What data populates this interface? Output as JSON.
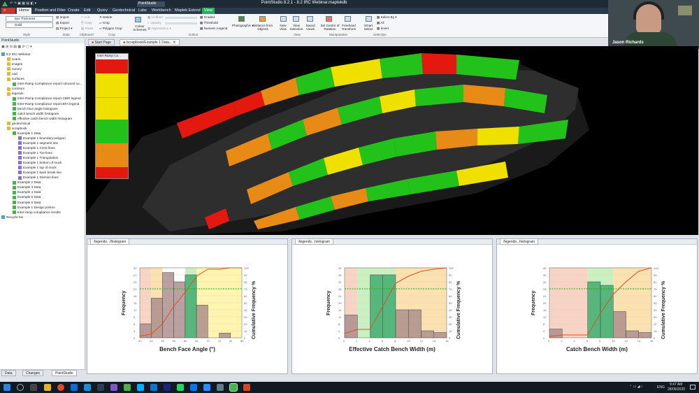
{
  "app": {
    "name": "PointStudio",
    "title": "PointStudio 8.2.1 - 8.2 IRC Webinar.maptekdb"
  },
  "menu": [
    "Home",
    "Position and Filter",
    "Create",
    "Edit",
    "Query",
    "Geotechnical",
    "Labs",
    "Workbench",
    "Maptek Extend",
    "View"
  ],
  "ribbon": {
    "style": {
      "thickness": "2px Thickness",
      "line": "Solid",
      "group": "Style"
    },
    "data": {
      "import": "Import",
      "export": "Export",
      "project": "Project",
      "group": "Data"
    },
    "clipboard": {
      "cut": "Cut",
      "copy": "Copy",
      "paste": "Paste",
      "group": "Clipboard"
    },
    "crop": {
      "delete": "Delete",
      "crop": "Crop",
      "polygon_crop": "Polygon Crop",
      "group": "Crop"
    },
    "colour": {
      "schemes": "Colour Schemes",
      "linflare": "Lin/flare",
      "opacity": "Opacity",
      "appearance": "Appearance",
      "graded": "Graded",
      "threshold": "Threshold",
      "numeric_legend": "Numeric Legend",
      "photographic": "Photographic",
      "distance": "Distance from Objects",
      "group": "Colour"
    },
    "view": {
      "new_view": "New View",
      "view_selection": "View Selection",
      "saved_views": "Saved Views",
      "group": "View"
    },
    "manipulation": {
      "centre": "Set Centre of Rotation",
      "freehand": "Freehand Transform",
      "group": "Manipulation"
    },
    "selection": {
      "smart": "Smart Select",
      "select_by": "Select By",
      "all": "All",
      "invert": "Invert",
      "group": "Selection"
    }
  },
  "webcam": {
    "name": "Jason Richards"
  },
  "project_panel": {
    "title": "PointStudio",
    "items": [
      {
        "label": "8.2 IRC Webinar",
        "level": 0
      },
      {
        "label": "scans",
        "level": 1
      },
      {
        "label": "images",
        "level": 1
      },
      {
        "label": "survey",
        "level": 1
      },
      {
        "label": "cad",
        "level": 1
      },
      {
        "label": "surfaces",
        "level": 1
      },
      {
        "label": "Inter-Ramp Compliance report coloured su...",
        "level": 2
      },
      {
        "label": "contours",
        "level": 1
      },
      {
        "label": "legends",
        "level": 1
      },
      {
        "label": "Inter-Ramp Compliance report CBW legend",
        "level": 2
      },
      {
        "label": "Inter-Ramp Compliance report BFA legend",
        "level": 2
      },
      {
        "label": "bench face angle histogram",
        "level": 2
      },
      {
        "label": "catch bench width histogram",
        "level": 2
      },
      {
        "label": "effective catch bench width histogram",
        "level": 2
      },
      {
        "label": "geotechnical",
        "level": 1
      },
      {
        "label": "scrapbook",
        "level": 1
      },
      {
        "label": "Example 1 Data",
        "level": 2
      },
      {
        "label": "Example 1 boundary polygon",
        "level": 3
      },
      {
        "label": "Example 1 segment line",
        "level": 3
      },
      {
        "label": "Example 1 Crest lines",
        "level": 3
      },
      {
        "label": "Example 1 Toe lines",
        "level": 3
      },
      {
        "label": "Example 1 Triangulation",
        "level": 3
      },
      {
        "label": "Example 1 bottom of muck",
        "level": 3
      },
      {
        "label": "Example 1 top of muck",
        "level": 3
      },
      {
        "label": "Example 1 back break line",
        "level": 3
      },
      {
        "label": "Example 1 Division lines",
        "level": 3
      },
      {
        "label": "Example 2 Data",
        "level": 2
      },
      {
        "label": "Example 3 Data",
        "level": 2
      },
      {
        "label": "Example 4 Data",
        "level": 2
      },
      {
        "label": "Example 5 Data",
        "level": 2
      },
      {
        "label": "Example 6 Data",
        "level": 2
      },
      {
        "label": "Example 1 Design portion",
        "level": 2
      },
      {
        "label": "Inter-ramp compliance results",
        "level": 2
      },
      {
        "label": "Recycle bin",
        "level": 0
      }
    ]
  },
  "view_tabs": [
    "Start Page",
    "/scrapbook/Example 1 Data..."
  ],
  "legend_title": "Inter-Ramp Co...",
  "bottom_tabs": [
    "Data",
    "Changes",
    "PointStudio"
  ],
  "histograms": [
    {
      "tab": "/legends.../histogram",
      "xlabel": "Bench Face Angle (°)",
      "ylabel": "Frequency",
      "y2label": "Cumulative Frequency %",
      "xticks": [
        "40",
        "45",
        "50",
        "55",
        "60",
        "65",
        "70",
        "75",
        "80",
        "85"
      ],
      "yticks": [
        "30",
        "27",
        "24",
        "21",
        "18",
        "15",
        "12",
        "9",
        "6",
        "3",
        "0"
      ],
      "y2ticks": [
        "100",
        "90",
        "80",
        "70",
        "60",
        "50",
        "40",
        "30",
        "20",
        "10",
        "0"
      ]
    },
    {
      "tab": "/legends...histogram",
      "xlabel": "Effective Catch Bench Width (m)",
      "ylabel": "Frequency",
      "y2label": "Cumulative Frequency %",
      "xticks": [
        "0",
        "2",
        "4",
        "6",
        "8",
        "10",
        "12",
        "14",
        "16"
      ],
      "yticks": [
        "40",
        "36",
        "32",
        "28",
        "24",
        "20",
        "16",
        "12",
        "8",
        "4",
        "0"
      ],
      "y2ticks": [
        "100",
        "90",
        "80",
        "70",
        "60",
        "50",
        "40",
        "30",
        "20",
        "10",
        "0"
      ]
    },
    {
      "tab": "/legends...histogram",
      "xlabel": "Catch Bench Width (m)",
      "ylabel": "Frequency",
      "y2label": "Cumulative Frequency %",
      "xticks": [
        "0",
        "2",
        "4",
        "6",
        "8",
        "10",
        "12",
        "14",
        "16"
      ],
      "yticks": [
        "40",
        "36",
        "32",
        "28",
        "24",
        "20",
        "16",
        "12",
        "8",
        "4",
        "0"
      ],
      "y2ticks": [
        "100",
        "90",
        "80",
        "70",
        "60",
        "50",
        "40",
        "30",
        "20",
        "10",
        "0"
      ]
    }
  ],
  "chart_data": [
    {
      "type": "bar",
      "xlabel": "Bench Face Angle (°)",
      "ylabel": "Frequency",
      "xlim": [
        40,
        85
      ],
      "ylim": [
        0,
        30
      ],
      "bins": [
        [
          40,
          45
        ],
        [
          45,
          50
        ],
        [
          50,
          55
        ],
        [
          55,
          60
        ],
        [
          60,
          65
        ],
        [
          65,
          70
        ],
        [
          70,
          75
        ],
        [
          75,
          80
        ],
        [
          80,
          85
        ]
      ],
      "values": [
        6,
        17,
        28,
        24,
        27,
        14,
        0,
        2,
        0
      ],
      "cumulative_percent": [
        5,
        20,
        45,
        65,
        88,
        98,
        98,
        100,
        100
      ]
    },
    {
      "type": "bar",
      "xlabel": "Effective Catch Bench Width (m)",
      "ylabel": "Frequency",
      "xlim": [
        0,
        16
      ],
      "ylim": [
        0,
        40
      ],
      "bins": [
        [
          0,
          2
        ],
        [
          2,
          4
        ],
        [
          4,
          6
        ],
        [
          6,
          8
        ],
        [
          8,
          10
        ],
        [
          10,
          12
        ],
        [
          12,
          14
        ],
        [
          14,
          16
        ]
      ],
      "values": [
        13,
        0,
        36,
        36,
        16,
        16,
        4,
        3
      ],
      "cumulative_percent": [
        12,
        12,
        45,
        78,
        88,
        95,
        98,
        100
      ]
    },
    {
      "type": "bar",
      "xlabel": "Catch Bench Width (m)",
      "ylabel": "Frequency",
      "xlim": [
        0,
        16
      ],
      "ylim": [
        0,
        40
      ],
      "bins": [
        [
          0,
          2
        ],
        [
          2,
          4
        ],
        [
          4,
          6
        ],
        [
          6,
          8
        ],
        [
          8,
          10
        ],
        [
          10,
          12
        ],
        [
          12,
          14
        ],
        [
          14,
          16
        ]
      ],
      "values": [
        5,
        0,
        0,
        32,
        30,
        15,
        4,
        3
      ],
      "cumulative_percent": [
        4,
        4,
        4,
        35,
        62,
        80,
        95,
        100
      ]
    }
  ],
  "taskbar": {
    "time": "9:47 AM",
    "date": "28/05/2020",
    "lang": "ENG"
  },
  "colors": {
    "red": "#e3180f",
    "yellow": "#f0e000",
    "green": "#22c21a",
    "orange": "#e88a16",
    "grey": "#3a3a3a"
  }
}
